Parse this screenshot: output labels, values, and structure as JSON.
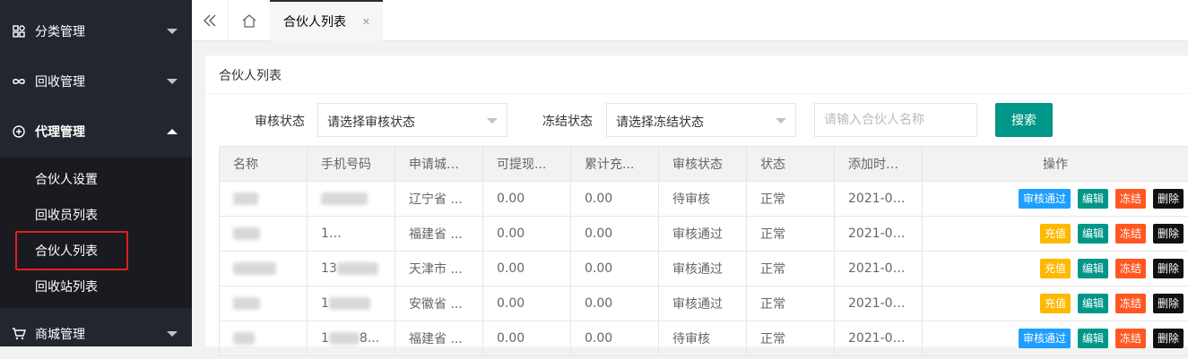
{
  "sidebar": {
    "groups": [
      {
        "label": "分类管理",
        "icon": "grid-icon"
      },
      {
        "label": "回收管理",
        "icon": "infinity-icon"
      },
      {
        "label": "代理管理",
        "icon": "plus-circle-icon"
      },
      {
        "label": "商城管理",
        "icon": "cart-icon"
      }
    ],
    "submenu": [
      "合伙人设置",
      "回收员列表",
      "合伙人列表",
      "回收站列表"
    ]
  },
  "topbar": {
    "tab_label": "合伙人列表",
    "collapse_icon": "double-chevron-left-icon",
    "home_icon": "home-icon",
    "close_icon": "close-icon"
  },
  "card": {
    "title": "合伙人列表"
  },
  "filters": {
    "audit_label": "审核状态",
    "audit_value": "请选择审核状态",
    "freeze_label": "冻结状态",
    "freeze_value": "请选择冻结状态",
    "name_placeholder": "请输入合伙人名称",
    "search_label": "搜索"
  },
  "table": {
    "headers": [
      "名称",
      "手机号码",
      "申请城市",
      "可提现...",
      "累计充...",
      "审核状态",
      "状态",
      "添加时间",
      "操作"
    ],
    "rows": [
      {
        "phone_prefix": "",
        "phone_suffix": "",
        "city": "辽宁省 ...",
        "withdrawable": "0.00",
        "recharged": "0.00",
        "audit": "待审核",
        "status": "正常",
        "added": "2021-02...",
        "actions": [
          "审核通过",
          "编辑",
          "冻结",
          "删除"
        ]
      },
      {
        "phone_prefix": "1",
        "phone_suffix": "4...",
        "city": "福建省 ...",
        "withdrawable": "0.00",
        "recharged": "0.00",
        "audit": "审核通过",
        "status": "正常",
        "added": "2021-02...",
        "actions": [
          "充值",
          "编辑",
          "冻结",
          "删除"
        ]
      },
      {
        "phone_prefix": "13",
        "phone_suffix": "",
        "city": "天津市 ...",
        "withdrawable": "0.00",
        "recharged": "0.00",
        "audit": "审核通过",
        "status": "正常",
        "added": "2021-02...",
        "actions": [
          "充值",
          "编辑",
          "冻结",
          "删除"
        ]
      },
      {
        "phone_prefix": "1",
        "phone_suffix": "",
        "city": "安徽省 ...",
        "withdrawable": "0.00",
        "recharged": "0.00",
        "audit": "审核通过",
        "status": "正常",
        "added": "2021-02...",
        "actions": [
          "充值",
          "编辑",
          "冻结",
          "删除"
        ]
      },
      {
        "phone_prefix": "1",
        "phone_suffix": "8...",
        "city": "福建省 ...",
        "withdrawable": "0.00",
        "recharged": "0.00",
        "audit": "待审核",
        "status": "正常",
        "added": "2021-01...",
        "actions": [
          "审核通过",
          "编辑",
          "冻结",
          "删除"
        ]
      }
    ]
  },
  "colors": {
    "sidebar_bg": "#23262e",
    "submenu_bg": "#191b21",
    "primary": "#009688",
    "blue": "#1e9fff",
    "orange": "#ff5722",
    "yellow": "#ffb800",
    "highlight": "#e02020"
  }
}
